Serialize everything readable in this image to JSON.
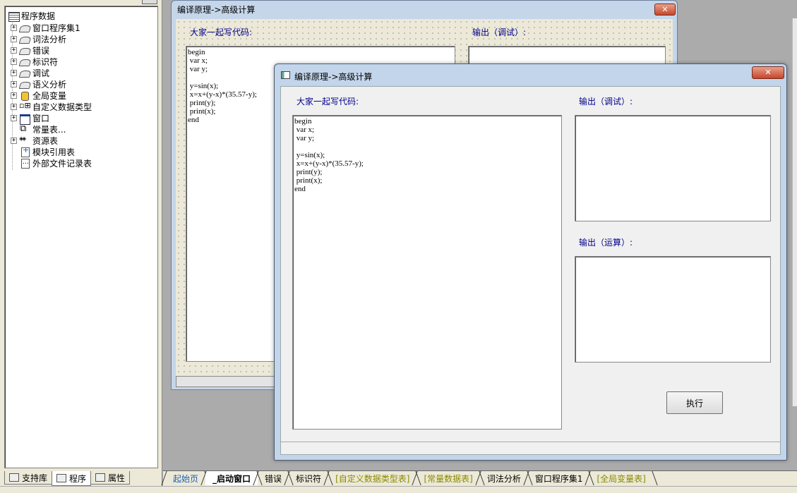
{
  "project_tree": {
    "root_label": "程序数据",
    "items": [
      {
        "label": "窗口程序集1",
        "icon": "book-icon",
        "expandable": true
      },
      {
        "label": "词法分析",
        "icon": "book-icon",
        "expandable": true
      },
      {
        "label": "错误",
        "icon": "book-icon",
        "expandable": true
      },
      {
        "label": "标识符",
        "icon": "book-icon",
        "expandable": true
      },
      {
        "label": "调试",
        "icon": "book-icon",
        "expandable": true
      },
      {
        "label": "语义分析",
        "icon": "book-icon",
        "expandable": true
      },
      {
        "label": "全局变量",
        "icon": "database-icon",
        "expandable": true
      },
      {
        "label": "自定义数据类型",
        "icon": "data-type-icon",
        "expandable": true
      },
      {
        "label": "窗口",
        "icon": "window-icon",
        "expandable": true
      },
      {
        "label": "常量表...",
        "icon": "constant-table-icon",
        "expandable": false
      },
      {
        "label": "资源表",
        "icon": "resource-icon",
        "expandable": true
      },
      {
        "label": "模块引用表",
        "icon": "module-ref-icon",
        "expandable": false
      },
      {
        "label": "外部文件记录表",
        "icon": "external-file-icon",
        "expandable": false
      }
    ]
  },
  "left_tabs": [
    {
      "label": "支持库",
      "active": false
    },
    {
      "label": "程序",
      "active": true
    },
    {
      "label": "属性",
      "active": false
    }
  ],
  "design_window": {
    "title": "编译原理->高级计算",
    "code_label": "大家一起写代码:",
    "output_label": "输出（调试）:",
    "code_text": "begin\n var x;\n var y;\n\n y=sin(x);\n x=x+(y-x)*(35.57-y);\n print(y);\n print(x);\nend"
  },
  "run_window": {
    "title": "编译原理->高级计算",
    "code_label": "大家一起写代码:",
    "debug_output_label": "输出（调试）:",
    "run_output_label": "输出（运算）:",
    "code_text": "begin\n var x;\n var y;\n\n y=sin(x);\n x=x+(y-x)*(35.57-y);\n print(y);\n print(x);\nend",
    "execute_button": "执行"
  },
  "doc_tabs": [
    {
      "label": "起始页",
      "active": false,
      "color": "#1a5fb4"
    },
    {
      "label": "_启动窗口",
      "active": true,
      "color": "#000000"
    },
    {
      "label": "错误",
      "active": false,
      "color": "#000000"
    },
    {
      "label": "标识符",
      "active": false,
      "color": "#000000"
    },
    {
      "label": "[自定义数据类型表]",
      "active": false,
      "color": "#8a8a00"
    },
    {
      "label": "[常量数据表]",
      "active": false,
      "color": "#8a8a00"
    },
    {
      "label": "词法分析",
      "active": false,
      "color": "#000000"
    },
    {
      "label": "窗口程序集1",
      "active": false,
      "color": "#000000"
    },
    {
      "label": "[全局变量表]",
      "active": false,
      "color": "#8a8a00"
    }
  ],
  "colors": {
    "label_blue": "#00008b",
    "close_red": "#c5462c",
    "panel_bg": "#ece9d8",
    "workspace_bg": "#ababab"
  }
}
